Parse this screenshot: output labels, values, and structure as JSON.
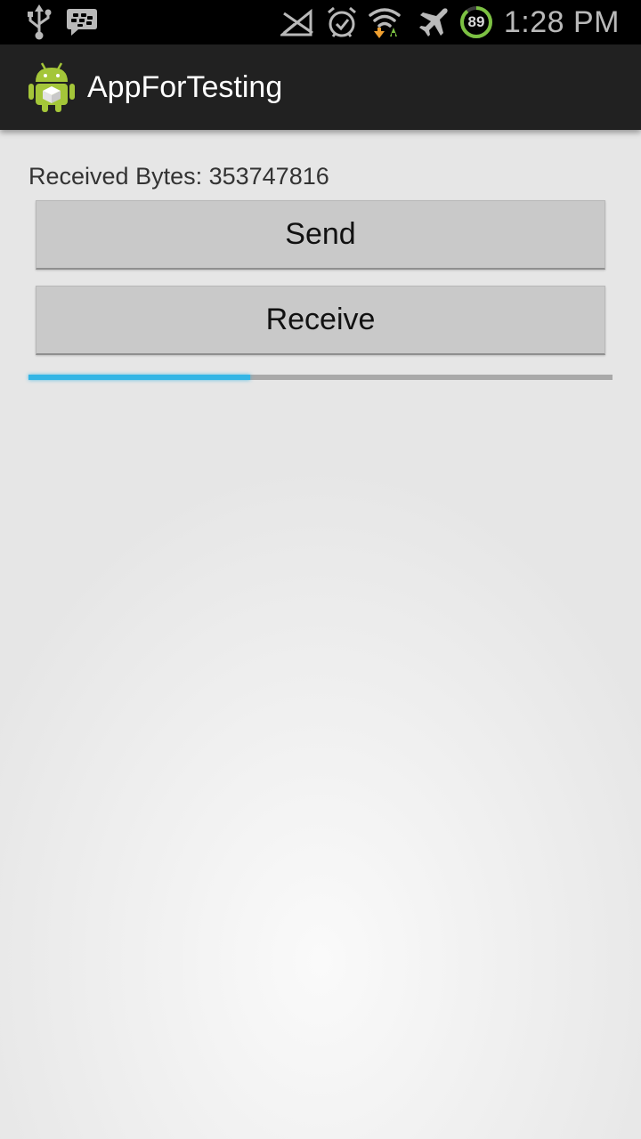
{
  "status_bar": {
    "icons": [
      "usb-icon",
      "bbm-icon",
      "no-signal-icon",
      "alarm-icon",
      "wifi-icon",
      "airplane-mode-icon",
      "battery-icon"
    ],
    "battery_level": "89",
    "time": "1:28 PM"
  },
  "action_bar": {
    "title": "AppForTesting",
    "icon": "android-icon"
  },
  "main": {
    "received_label": "Received Bytes: 353747816",
    "send_button": "Send",
    "receive_button": "Receive",
    "progress_fraction": 0.38
  },
  "colors": {
    "accent": "#33b5e5",
    "battery_ring": "#7cc142",
    "action_bar": "#212121",
    "status_bar": "#000000"
  }
}
